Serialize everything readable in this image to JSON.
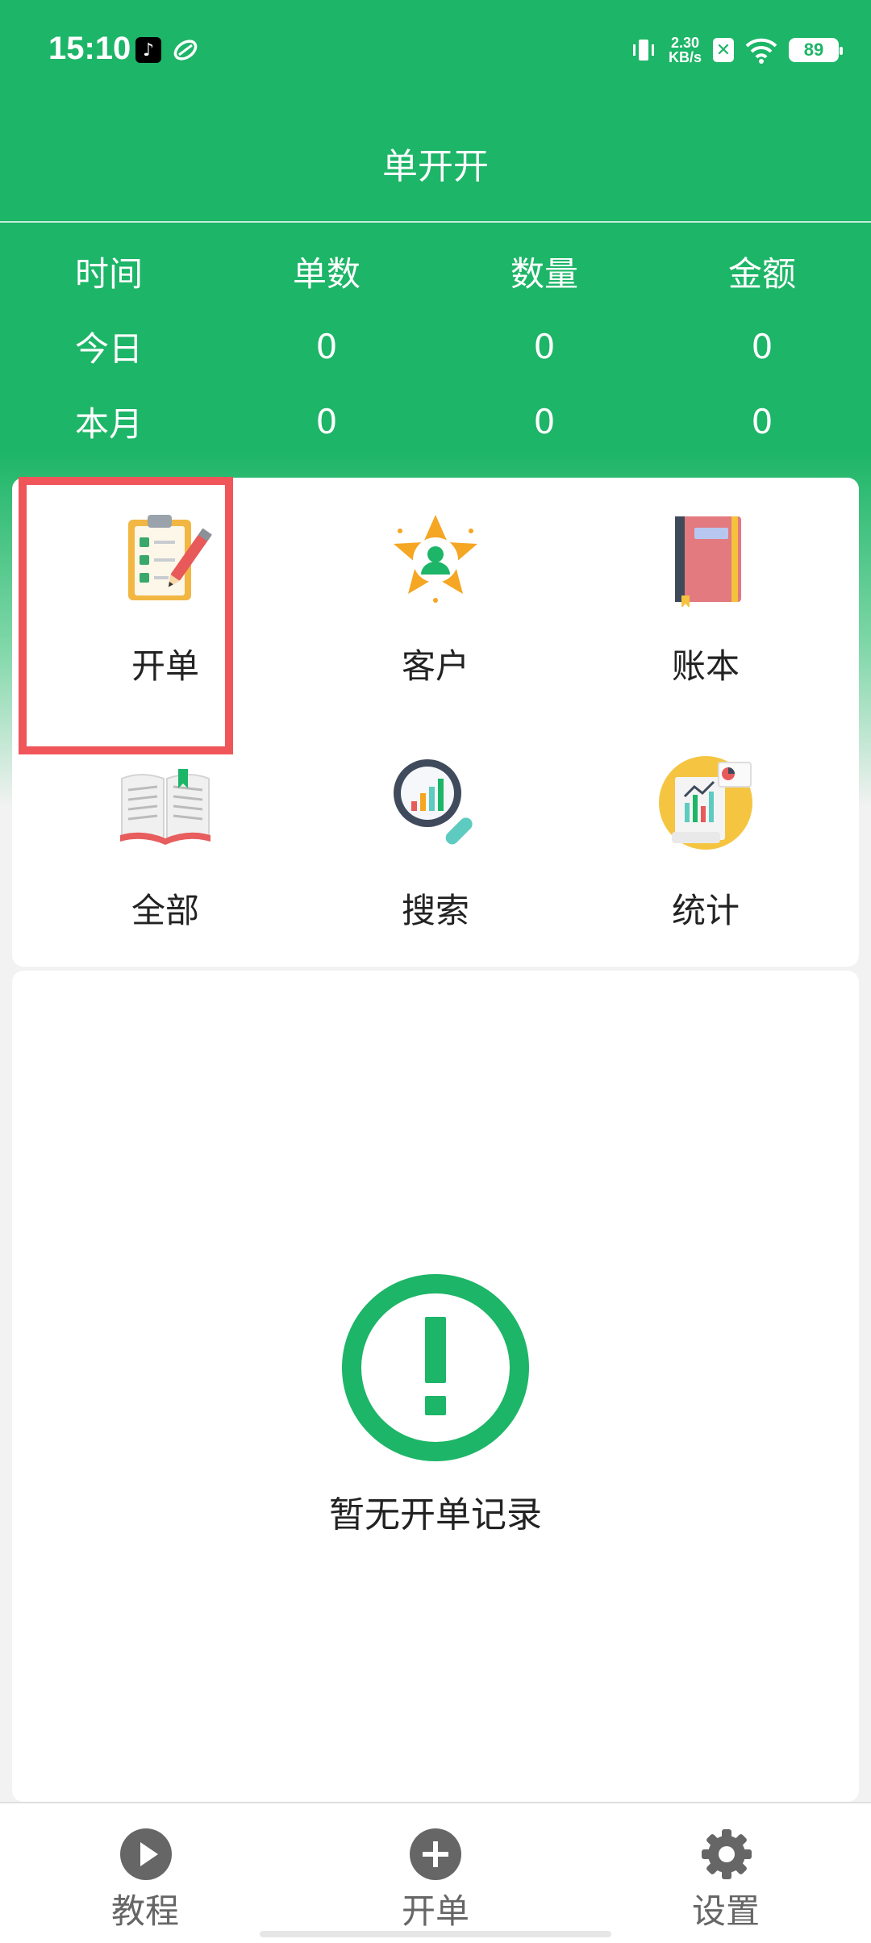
{
  "status_bar": {
    "time": "15:10",
    "net_speed_value": "2.30",
    "net_speed_unit": "KB/s",
    "battery": "89"
  },
  "app": {
    "title": "单开开"
  },
  "stats": {
    "headers": [
      "时间",
      "单数",
      "数量",
      "金额"
    ],
    "rows": [
      [
        "今日",
        "0",
        "0",
        "0"
      ],
      [
        "本月",
        "0",
        "0",
        "0"
      ]
    ]
  },
  "menu": {
    "items": [
      {
        "label": "开单",
        "icon": "clipboard-icon"
      },
      {
        "label": "客户",
        "icon": "customer-star-icon"
      },
      {
        "label": "账本",
        "icon": "ledger-book-icon"
      },
      {
        "label": "全部",
        "icon": "open-book-icon"
      },
      {
        "label": "搜索",
        "icon": "search-chart-icon"
      },
      {
        "label": "统计",
        "icon": "statistics-icon"
      }
    ]
  },
  "empty_state": {
    "text": "暂无开单记录",
    "icon": "exclamation-circle-icon"
  },
  "bottom_nav": {
    "items": [
      {
        "label": "教程",
        "icon": "play-icon"
      },
      {
        "label": "开单",
        "icon": "plus-icon"
      },
      {
        "label": "设置",
        "icon": "gear-icon"
      }
    ]
  },
  "colors": {
    "primary": "#1db567",
    "highlight": "#f0555a"
  }
}
